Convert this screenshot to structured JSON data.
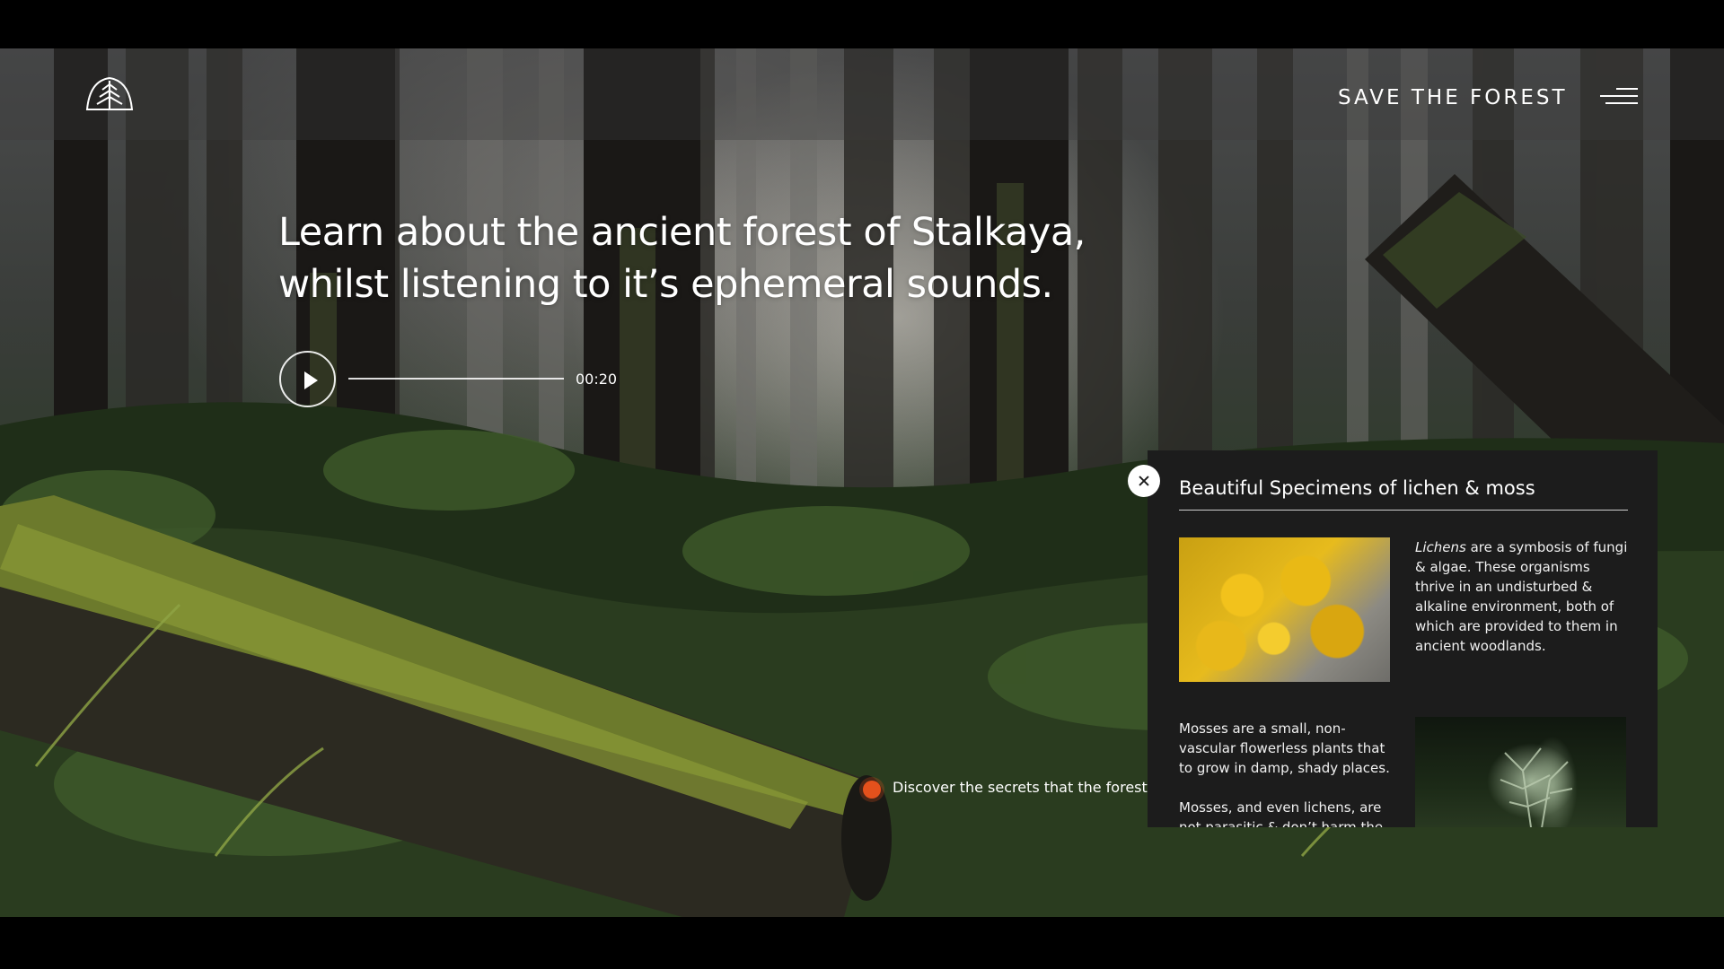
{
  "header": {
    "brand_title": "SAVE THE FOREST",
    "logo_icon": "pine-tree-icon",
    "menu_icon": "hamburger-menu-icon"
  },
  "hero": {
    "headline": "Learn about the ancient forest of Stalkaya, whilst listening to it’s ephemeral sounds.",
    "player": {
      "play_icon": "play-icon",
      "time": "00:20"
    }
  },
  "hotspot": {
    "label": "Discover the secrets that the forest floor"
  },
  "info_panel": {
    "close_icon": "close-icon",
    "title": "Beautiful Specimens of lichen & moss",
    "lichen": {
      "term": "Lichens",
      "text": " are a symbosis of fungi & algae. These organisms thrive in an undisturbed & alkaline environment, both of which are provided to them in ancient woodlands."
    },
    "moss": {
      "paragraph_1": "Mosses are a small, non-vascular flowerless plants that to grow in damp, shady places.",
      "paragraph_2": "Mosses, and even lichens, are not parasitic & don’t harm the trees."
    }
  },
  "colors": {
    "hotspot_accent": "#e4511c",
    "panel_background": "#1c1c1c",
    "text": "#ffffff"
  }
}
